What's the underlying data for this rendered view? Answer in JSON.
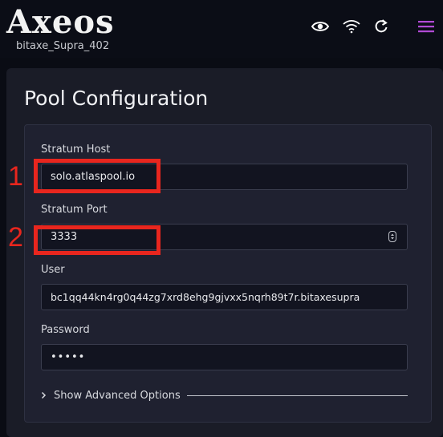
{
  "header": {
    "logo_text": "Axeos",
    "device_name": "bitaxe_Supra_402",
    "icons": [
      "eye-icon",
      "wifi-icon",
      "refresh-icon",
      "menu-icon"
    ],
    "accent_color": "#b24bd6"
  },
  "page": {
    "title": "Pool Configuration"
  },
  "form": {
    "stratum_host": {
      "label": "Stratum Host",
      "value": "solo.atlaspool.io"
    },
    "stratum_port": {
      "label": "Stratum Port",
      "value": "3333"
    },
    "user": {
      "label": "User",
      "value": "bc1qq44kn4rg0q44zg7xrd8ehg9gjvxx5nqrh89t7r.bitaxesupra"
    },
    "password": {
      "label": "Password",
      "value": "•••••"
    },
    "advanced_toggle": {
      "label": "Show Advanced Options",
      "icon": "chevron-right-icon"
    }
  },
  "annotations": {
    "marker_1": "1",
    "marker_2": "2",
    "highlight_color": "#e8261e"
  }
}
